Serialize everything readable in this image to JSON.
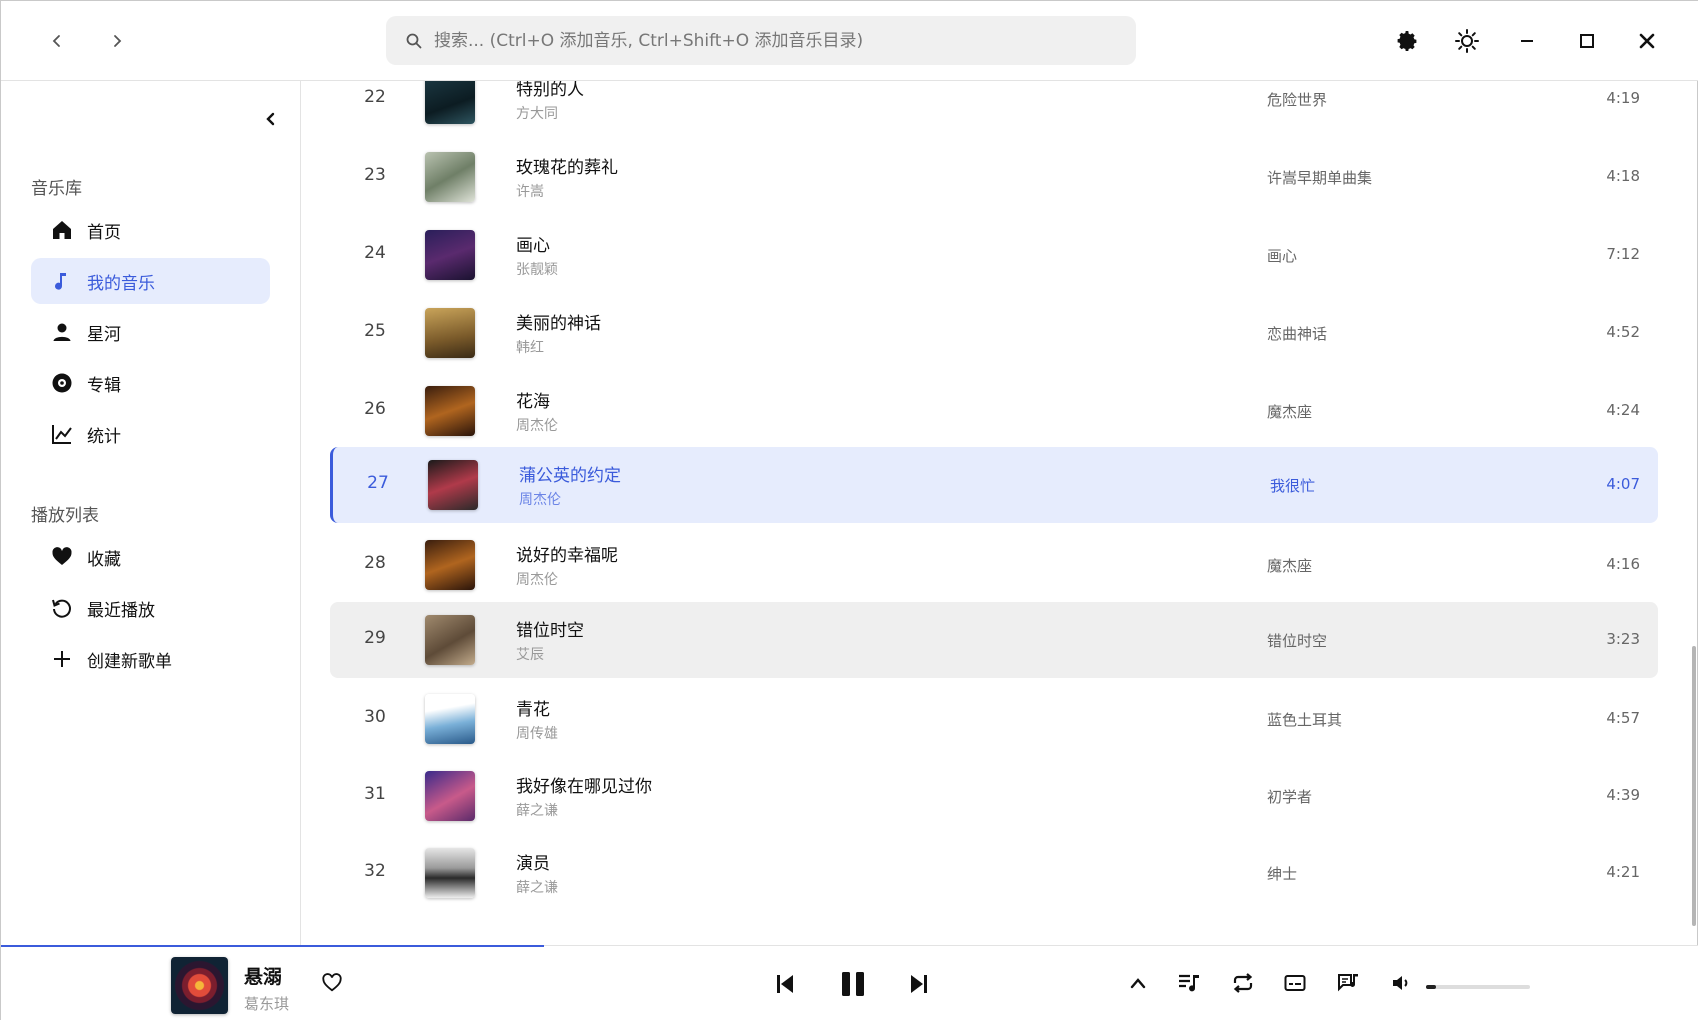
{
  "search": {
    "placeholder": "搜索... (Ctrl+O 添加音乐, Ctrl+Shift+O 添加音乐目录)"
  },
  "sidebar": {
    "library_title": "音乐库",
    "library_items": [
      {
        "label": "首页",
        "icon": "home-icon"
      },
      {
        "label": "我的音乐",
        "icon": "music-note-icon",
        "active": true
      },
      {
        "label": "星河",
        "icon": "person-icon"
      },
      {
        "label": "专辑",
        "icon": "disc-icon"
      },
      {
        "label": "统计",
        "icon": "chart-icon"
      }
    ],
    "playlist_title": "播放列表",
    "playlist_items": [
      {
        "label": "收藏",
        "icon": "heart-icon"
      },
      {
        "label": "最近播放",
        "icon": "history-icon"
      },
      {
        "label": "创建新歌单",
        "icon": "plus-icon"
      }
    ]
  },
  "songs": [
    {
      "num": "22",
      "title": "特别的人",
      "artist": "方大同",
      "album": "危险世界",
      "duration": "4:19"
    },
    {
      "num": "23",
      "title": "玫瑰花的葬礼",
      "artist": "许嵩",
      "album": "许嵩早期单曲集",
      "duration": "4:18"
    },
    {
      "num": "24",
      "title": "画心",
      "artist": "张靓颖",
      "album": "画心",
      "duration": "7:12"
    },
    {
      "num": "25",
      "title": "美丽的神话",
      "artist": "韩红",
      "album": "恋曲神话",
      "duration": "4:52"
    },
    {
      "num": "26",
      "title": "花海",
      "artist": "周杰伦",
      "album": "魔杰座",
      "duration": "4:24"
    },
    {
      "num": "27",
      "title": "蒲公英的约定",
      "artist": "周杰伦",
      "album": "我很忙",
      "duration": "4:07"
    },
    {
      "num": "28",
      "title": "说好的幸福呢",
      "artist": "周杰伦",
      "album": "魔杰座",
      "duration": "4:16"
    },
    {
      "num": "29",
      "title": "错位时空",
      "artist": "艾辰",
      "album": "错位时空",
      "duration": "3:23"
    },
    {
      "num": "30",
      "title": "青花",
      "artist": "周传雄",
      "album": "蓝色土耳其",
      "duration": "4:57"
    },
    {
      "num": "31",
      "title": "我好像在哪见过你",
      "artist": "薛之谦",
      "album": "初学者",
      "duration": "4:39"
    },
    {
      "num": "32",
      "title": "演员",
      "artist": "薛之谦",
      "album": "绅士",
      "duration": "4:21"
    }
  ],
  "player": {
    "title": "悬溺",
    "artist": "葛东琪",
    "progress": 0.32,
    "volume": 0.1
  },
  "colors": {
    "accent": "#3b5bdb",
    "active_bg": "#e6ecfd",
    "hover_bg": "#efefef"
  }
}
